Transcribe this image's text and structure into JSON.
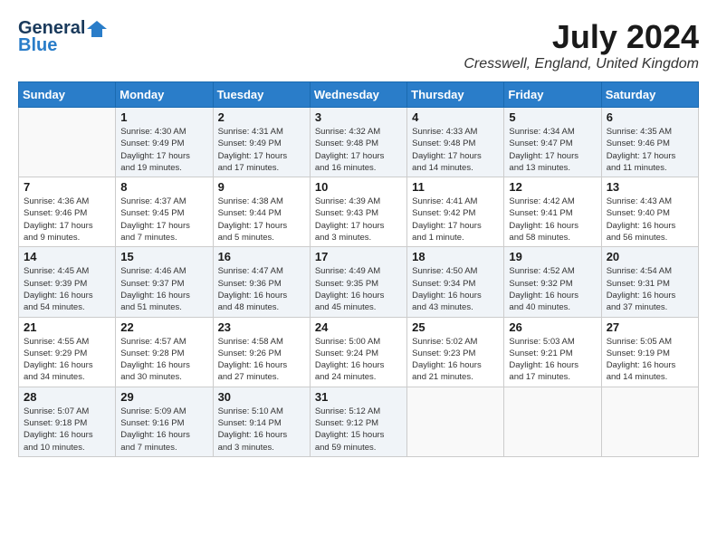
{
  "logo": {
    "line1": "General",
    "line2": "Blue"
  },
  "title": "July 2024",
  "location": "Cresswell, England, United Kingdom",
  "headers": [
    "Sunday",
    "Monday",
    "Tuesday",
    "Wednesday",
    "Thursday",
    "Friday",
    "Saturday"
  ],
  "weeks": [
    [
      {
        "day": "",
        "info": ""
      },
      {
        "day": "1",
        "info": "Sunrise: 4:30 AM\nSunset: 9:49 PM\nDaylight: 17 hours\nand 19 minutes."
      },
      {
        "day": "2",
        "info": "Sunrise: 4:31 AM\nSunset: 9:49 PM\nDaylight: 17 hours\nand 17 minutes."
      },
      {
        "day": "3",
        "info": "Sunrise: 4:32 AM\nSunset: 9:48 PM\nDaylight: 17 hours\nand 16 minutes."
      },
      {
        "day": "4",
        "info": "Sunrise: 4:33 AM\nSunset: 9:48 PM\nDaylight: 17 hours\nand 14 minutes."
      },
      {
        "day": "5",
        "info": "Sunrise: 4:34 AM\nSunset: 9:47 PM\nDaylight: 17 hours\nand 13 minutes."
      },
      {
        "day": "6",
        "info": "Sunrise: 4:35 AM\nSunset: 9:46 PM\nDaylight: 17 hours\nand 11 minutes."
      }
    ],
    [
      {
        "day": "7",
        "info": "Sunrise: 4:36 AM\nSunset: 9:46 PM\nDaylight: 17 hours\nand 9 minutes."
      },
      {
        "day": "8",
        "info": "Sunrise: 4:37 AM\nSunset: 9:45 PM\nDaylight: 17 hours\nand 7 minutes."
      },
      {
        "day": "9",
        "info": "Sunrise: 4:38 AM\nSunset: 9:44 PM\nDaylight: 17 hours\nand 5 minutes."
      },
      {
        "day": "10",
        "info": "Sunrise: 4:39 AM\nSunset: 9:43 PM\nDaylight: 17 hours\nand 3 minutes."
      },
      {
        "day": "11",
        "info": "Sunrise: 4:41 AM\nSunset: 9:42 PM\nDaylight: 17 hours\nand 1 minute."
      },
      {
        "day": "12",
        "info": "Sunrise: 4:42 AM\nSunset: 9:41 PM\nDaylight: 16 hours\nand 58 minutes."
      },
      {
        "day": "13",
        "info": "Sunrise: 4:43 AM\nSunset: 9:40 PM\nDaylight: 16 hours\nand 56 minutes."
      }
    ],
    [
      {
        "day": "14",
        "info": "Sunrise: 4:45 AM\nSunset: 9:39 PM\nDaylight: 16 hours\nand 54 minutes."
      },
      {
        "day": "15",
        "info": "Sunrise: 4:46 AM\nSunset: 9:37 PM\nDaylight: 16 hours\nand 51 minutes."
      },
      {
        "day": "16",
        "info": "Sunrise: 4:47 AM\nSunset: 9:36 PM\nDaylight: 16 hours\nand 48 minutes."
      },
      {
        "day": "17",
        "info": "Sunrise: 4:49 AM\nSunset: 9:35 PM\nDaylight: 16 hours\nand 45 minutes."
      },
      {
        "day": "18",
        "info": "Sunrise: 4:50 AM\nSunset: 9:34 PM\nDaylight: 16 hours\nand 43 minutes."
      },
      {
        "day": "19",
        "info": "Sunrise: 4:52 AM\nSunset: 9:32 PM\nDaylight: 16 hours\nand 40 minutes."
      },
      {
        "day": "20",
        "info": "Sunrise: 4:54 AM\nSunset: 9:31 PM\nDaylight: 16 hours\nand 37 minutes."
      }
    ],
    [
      {
        "day": "21",
        "info": "Sunrise: 4:55 AM\nSunset: 9:29 PM\nDaylight: 16 hours\nand 34 minutes."
      },
      {
        "day": "22",
        "info": "Sunrise: 4:57 AM\nSunset: 9:28 PM\nDaylight: 16 hours\nand 30 minutes."
      },
      {
        "day": "23",
        "info": "Sunrise: 4:58 AM\nSunset: 9:26 PM\nDaylight: 16 hours\nand 27 minutes."
      },
      {
        "day": "24",
        "info": "Sunrise: 5:00 AM\nSunset: 9:24 PM\nDaylight: 16 hours\nand 24 minutes."
      },
      {
        "day": "25",
        "info": "Sunrise: 5:02 AM\nSunset: 9:23 PM\nDaylight: 16 hours\nand 21 minutes."
      },
      {
        "day": "26",
        "info": "Sunrise: 5:03 AM\nSunset: 9:21 PM\nDaylight: 16 hours\nand 17 minutes."
      },
      {
        "day": "27",
        "info": "Sunrise: 5:05 AM\nSunset: 9:19 PM\nDaylight: 16 hours\nand 14 minutes."
      }
    ],
    [
      {
        "day": "28",
        "info": "Sunrise: 5:07 AM\nSunset: 9:18 PM\nDaylight: 16 hours\nand 10 minutes."
      },
      {
        "day": "29",
        "info": "Sunrise: 5:09 AM\nSunset: 9:16 PM\nDaylight: 16 hours\nand 7 minutes."
      },
      {
        "day": "30",
        "info": "Sunrise: 5:10 AM\nSunset: 9:14 PM\nDaylight: 16 hours\nand 3 minutes."
      },
      {
        "day": "31",
        "info": "Sunrise: 5:12 AM\nSunset: 9:12 PM\nDaylight: 15 hours\nand 59 minutes."
      },
      {
        "day": "",
        "info": ""
      },
      {
        "day": "",
        "info": ""
      },
      {
        "day": "",
        "info": ""
      }
    ]
  ]
}
